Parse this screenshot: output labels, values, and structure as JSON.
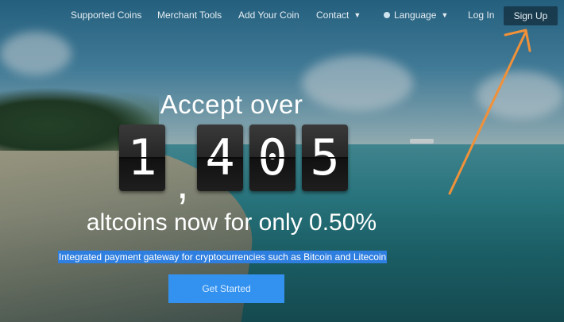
{
  "nav": {
    "supported_coins": "Supported Coins",
    "merchant_tools": "Merchant Tools",
    "add_your_coin": "Add Your Coin",
    "contact": "Contact",
    "language": "Language",
    "login": "Log In",
    "signup": "Sign Up"
  },
  "hero": {
    "headline_top": "Accept over",
    "digits": [
      "1",
      "4",
      "0",
      "5"
    ],
    "comma": ",",
    "headline_bottom": "altcoins now for only 0.50%",
    "subline": "Integrated payment gateway for cryptocurrencies such as Bitcoin and Litecoin",
    "cta": "Get Started"
  },
  "icons": {
    "dropdown": "chevron-down-icon",
    "language": "globe-icon",
    "annotation": "orange-arrow"
  },
  "colors": {
    "annotation_arrow": "#f0913a",
    "cta_background": "#3392f0",
    "subline_highlight": "#2f7fe0"
  }
}
